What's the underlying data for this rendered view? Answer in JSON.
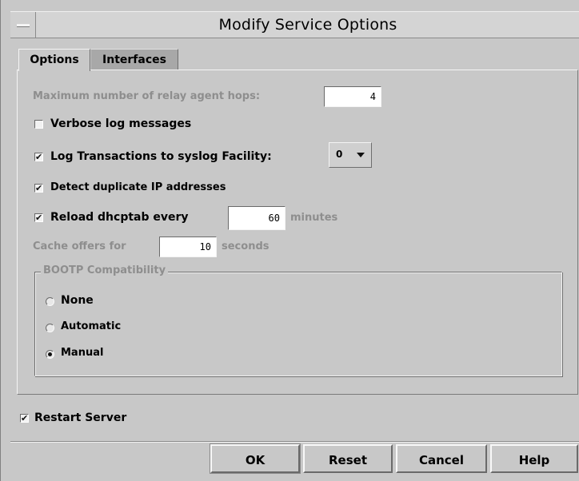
{
  "window": {
    "title": "Modify Service Options"
  },
  "tabs": [
    {
      "label": "Options",
      "active": true
    },
    {
      "label": "Interfaces",
      "active": false
    }
  ],
  "options": {
    "max_hops": {
      "label": "Maximum number of relay agent hops:",
      "value": "4",
      "enabled": false
    },
    "verbose": {
      "label": "Verbose log messages",
      "checked": false
    },
    "log_transactions": {
      "label": "Log Transactions to syslog Facility:",
      "checked": true,
      "facility": "0"
    },
    "detect_duplicate": {
      "label": "Detect duplicate IP addresses",
      "checked": true
    },
    "reload": {
      "label": "Reload dhcptab every",
      "checked": true,
      "value": "60",
      "unit": "minutes"
    },
    "cache": {
      "label": "Cache offers for",
      "value": "10",
      "unit": "seconds"
    },
    "bootp": {
      "label": "BOOTP Compatibility",
      "options": [
        {
          "label": "None",
          "selected": false
        },
        {
          "label": "Automatic",
          "selected": false
        },
        {
          "label": "Manual",
          "selected": true
        }
      ]
    }
  },
  "restart": {
    "label": "Restart Server",
    "checked": true
  },
  "buttons": {
    "ok": "OK",
    "reset": "Reset",
    "cancel": "Cancel",
    "help": "Help"
  },
  "check_glyph": "✔"
}
